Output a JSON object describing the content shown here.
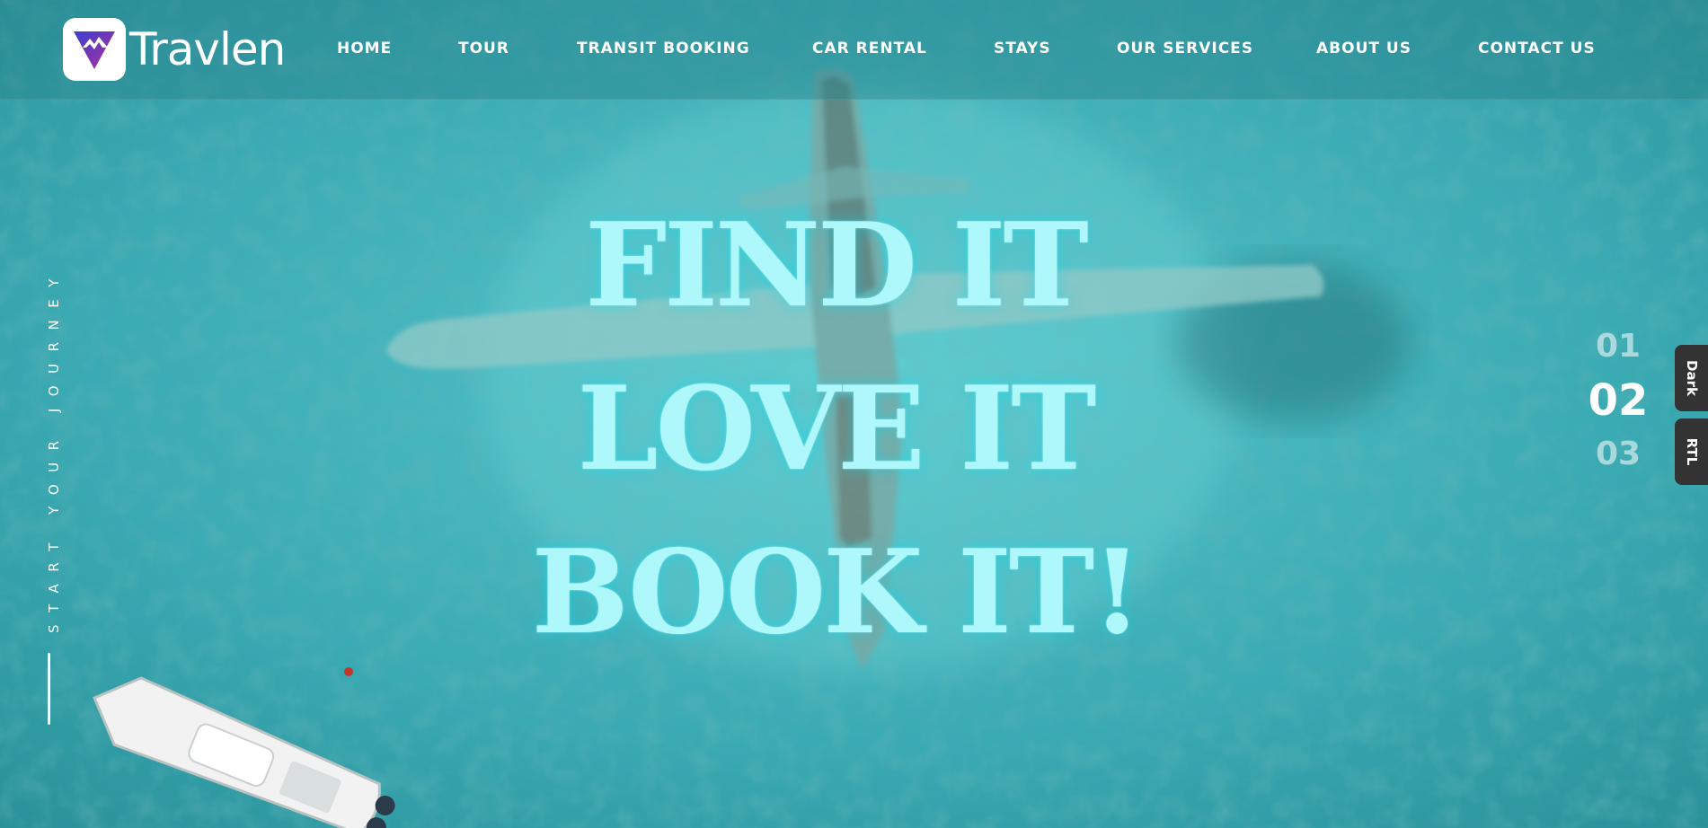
{
  "brand": {
    "name": "Travlen"
  },
  "nav": {
    "items": [
      {
        "label": "HOME"
      },
      {
        "label": "TOUR"
      },
      {
        "label": "TRANSIT BOOKING"
      },
      {
        "label": "CAR RENTAL"
      },
      {
        "label": "STAYS"
      },
      {
        "label": "OUR SERVICES"
      },
      {
        "label": "ABOUT US"
      },
      {
        "label": "CONTACT US"
      }
    ]
  },
  "hero": {
    "side_tag": "START YOUR JOURNEY",
    "headline": [
      "FIND IT",
      "LOVE IT",
      "BOOK IT!"
    ]
  },
  "slider": {
    "numbers": [
      "01",
      "02",
      "03"
    ],
    "active": "02"
  },
  "toggles": {
    "dark": "Dark",
    "rtl": "RTL"
  },
  "colors": {
    "accent_headline": "#aef7fb",
    "sea": "#3fb0b8",
    "toggle_bg": "#333333",
    "logo_gradient_start": "#3a3fd0",
    "logo_gradient_end": "#b0309a"
  }
}
